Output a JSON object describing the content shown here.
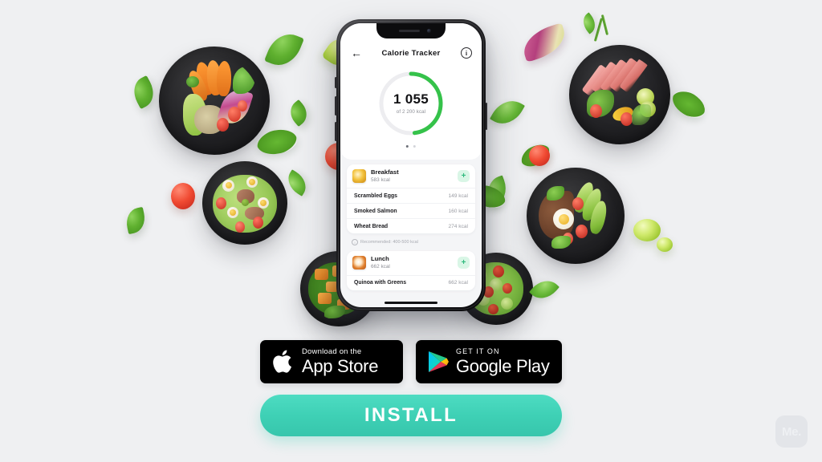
{
  "page": {
    "background_color": "#eff0f2",
    "accent_color": "#3ed0b5",
    "ring_color": "#35c24a"
  },
  "phone": {
    "app_bar": {
      "back_icon": "arrow-left-icon",
      "back_glyph": "←",
      "title": "Calorie Tracker",
      "info_icon": "info-circle-icon",
      "info_glyph": "i"
    },
    "calorie_ring": {
      "value": "1 055",
      "goal_label": "of 2 200 kcal",
      "progress_percent": 48,
      "track_color": "#ededf0",
      "progress_color": "#35c24a"
    },
    "pagination": {
      "total": 2,
      "active_index": 0
    },
    "meals": [
      {
        "name": "Breakfast",
        "kcal": "583 kcal",
        "thumb": "scrambled-eggs-thumb",
        "add_label": "+",
        "items": [
          {
            "name": "Scrambled Eggs",
            "kcal": "149 kcal"
          },
          {
            "name": "Smoked Salmon",
            "kcal": "160 kcal"
          },
          {
            "name": "Wheat Bread",
            "kcal": "274 kcal"
          }
        ]
      },
      {
        "name": "Lunch",
        "kcal": "662 kcal",
        "thumb": "quinoa-bowl-thumb",
        "add_label": "+",
        "items": [
          {
            "name": "Quinoa with Greens",
            "kcal": "662 kcal"
          }
        ]
      }
    ],
    "recommendation": {
      "icon": "info-circle-icon",
      "text": "Recommended: 400-500 kcal"
    }
  },
  "store_badges": [
    {
      "icon": "apple-logo-icon",
      "line1": "Download on the",
      "line2": "App Store"
    },
    {
      "icon": "google-play-icon",
      "line1": "GET IT ON",
      "line2": "Google Play"
    }
  ],
  "cta": {
    "label": "INSTALL"
  },
  "watermark": {
    "label": "Me."
  },
  "food_photos": [
    {
      "name": "sweet-potato-quinoa-bowl"
    },
    {
      "name": "seared-tuna-salad-bowl"
    },
    {
      "name": "tuna-egg-nicoise-salad-bowl"
    },
    {
      "name": "avocado-egg-quinoa-bowl"
    },
    {
      "name": "roasted-pumpkin-spinach-bowl"
    },
    {
      "name": "cucumber-tomato-herb-bowl"
    }
  ]
}
